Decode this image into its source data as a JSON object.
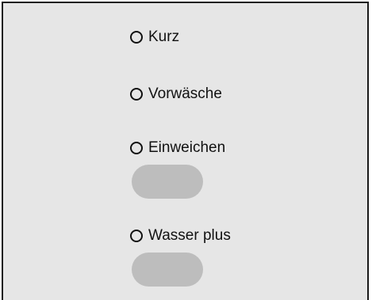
{
  "options": [
    {
      "label": "Kurz",
      "selected": false
    },
    {
      "label": "Vorwäsche",
      "selected": false
    },
    {
      "label": "Einweichen",
      "selected": false
    },
    {
      "label": "Wasser plus",
      "selected": false
    }
  ],
  "colors": {
    "panel_background": "#e6e6e6",
    "border": "#1a1a1a",
    "button_fill": "#bdbdbd",
    "text": "#111111"
  },
  "icons": {
    "radio": "radio-circle-icon"
  }
}
